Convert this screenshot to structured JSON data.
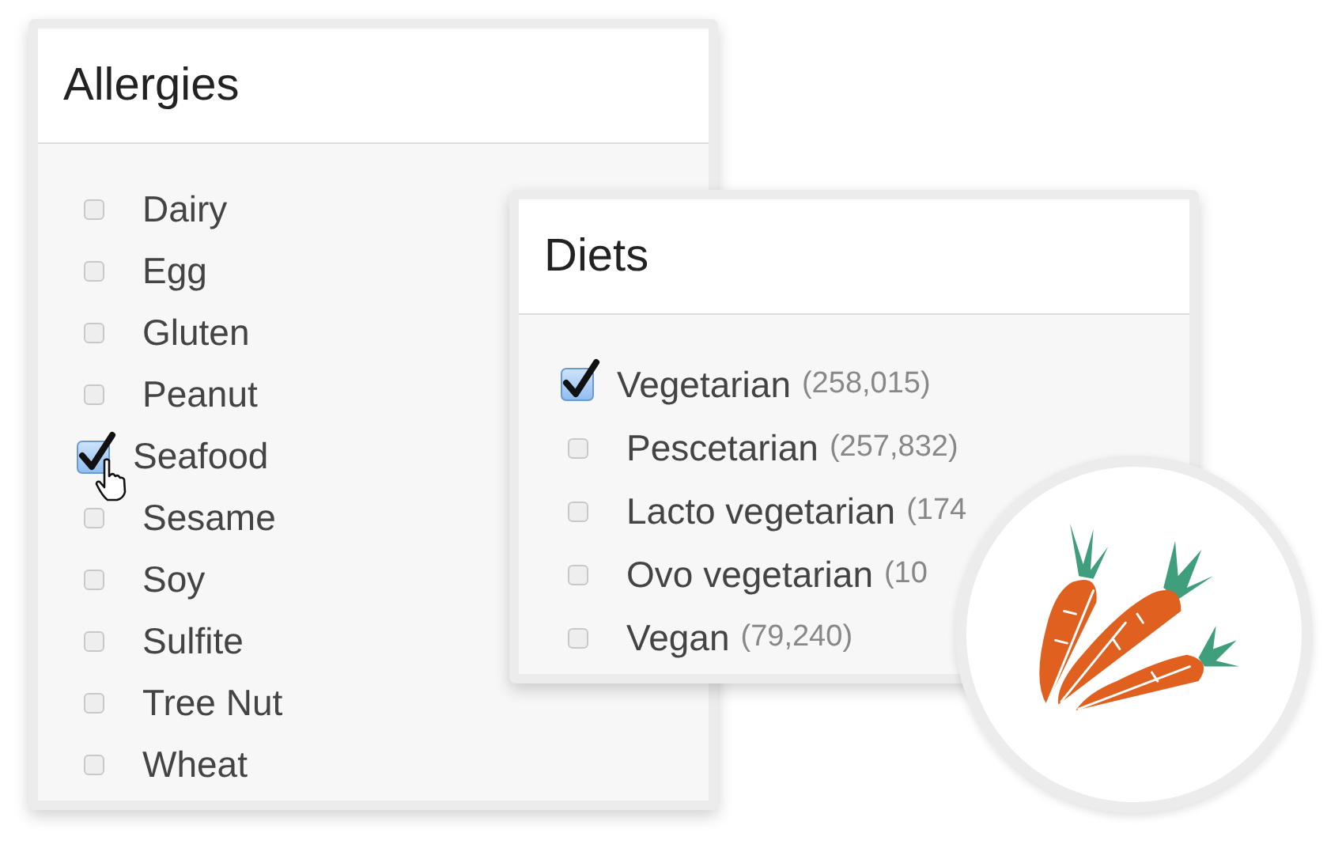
{
  "allergies": {
    "title": "Allergies",
    "items": [
      {
        "label": "Dairy",
        "checked": false
      },
      {
        "label": "Egg",
        "checked": false
      },
      {
        "label": "Gluten",
        "checked": false
      },
      {
        "label": "Peanut",
        "checked": false
      },
      {
        "label": "Seafood",
        "checked": true
      },
      {
        "label": "Sesame",
        "checked": false
      },
      {
        "label": "Soy",
        "checked": false
      },
      {
        "label": "Sulfite",
        "checked": false
      },
      {
        "label": "Tree Nut",
        "checked": false
      },
      {
        "label": "Wheat",
        "checked": false
      }
    ]
  },
  "diets": {
    "title": "Diets",
    "items": [
      {
        "label": "Vegetarian",
        "count": "(258,015)",
        "checked": true
      },
      {
        "label": "Pescetarian",
        "count": "(257,832)",
        "checked": false
      },
      {
        "label": "Lacto vegetarian",
        "count": "(174",
        "checked": false
      },
      {
        "label": "Ovo vegetarian",
        "count": "(10",
        "checked": false
      },
      {
        "label": "Vegan",
        "count": "(79,240)",
        "checked": false
      }
    ]
  }
}
